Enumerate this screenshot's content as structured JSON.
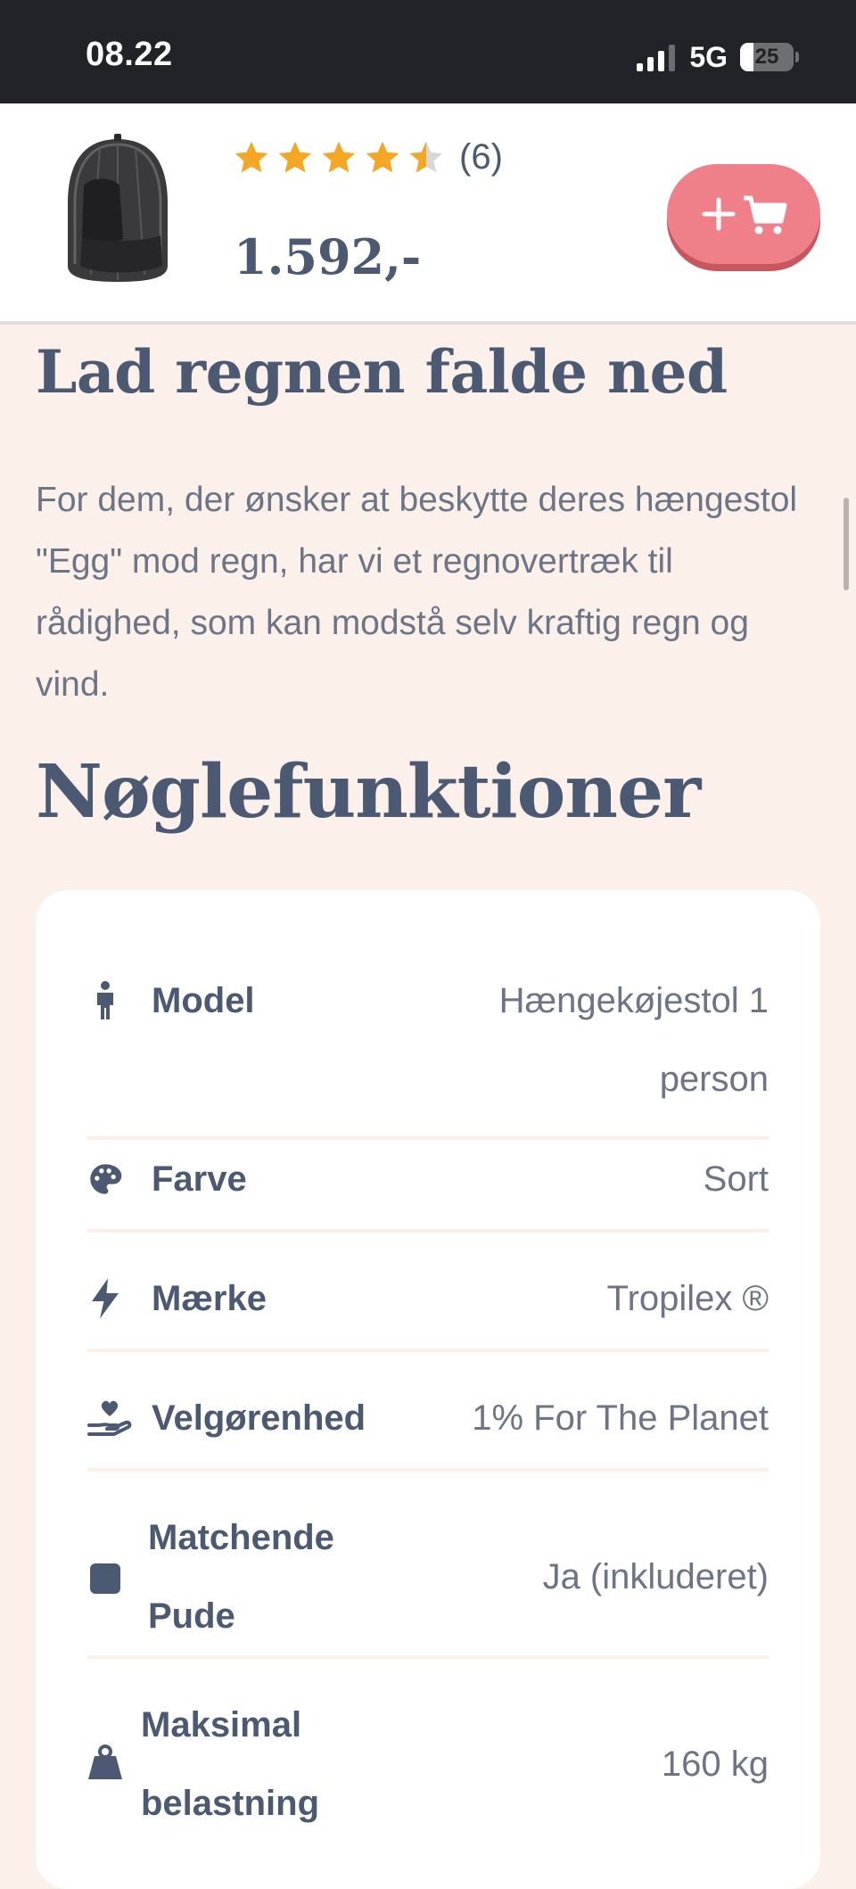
{
  "status_bar": {
    "time": "08.22",
    "network": "5G",
    "battery": "25",
    "battery_level": 0.25
  },
  "product_bar": {
    "rating": 4.5,
    "review_count": "(6)",
    "price": "1.592,-",
    "cart_button_icon": "plus-cart-icon"
  },
  "section": {
    "heading": "Lad regnen falde ned",
    "body": "For dem, der ønsker at beskytte deres hængestol \"Egg\" mod regn, har vi et regnovertræk til rådighed, som kan modstå selv kraftig regn og vind."
  },
  "features": {
    "heading": "Nøglefunktioner",
    "items": [
      {
        "icon": "person-icon",
        "label": "Model",
        "value": "Hængekøjestol 1 person"
      },
      {
        "icon": "palette-icon",
        "label": "Farve",
        "value": "Sort"
      },
      {
        "icon": "bolt-icon",
        "label": "Mærke",
        "value": "Tropilex ®"
      },
      {
        "icon": "hand-heart-icon",
        "label": "Velgørenhed",
        "value": "1% For The Planet"
      },
      {
        "icon": "square-icon",
        "label": "Matchende Pude",
        "value": "Ja (inkluderet)"
      },
      {
        "icon": "weight-icon",
        "label": "Maksimal belastning",
        "value": "160 kg"
      }
    ]
  },
  "colors": {
    "accent": "#ef7f88",
    "text": "#4b5a72",
    "star": "#f5a623",
    "background": "#fbf0ea"
  }
}
